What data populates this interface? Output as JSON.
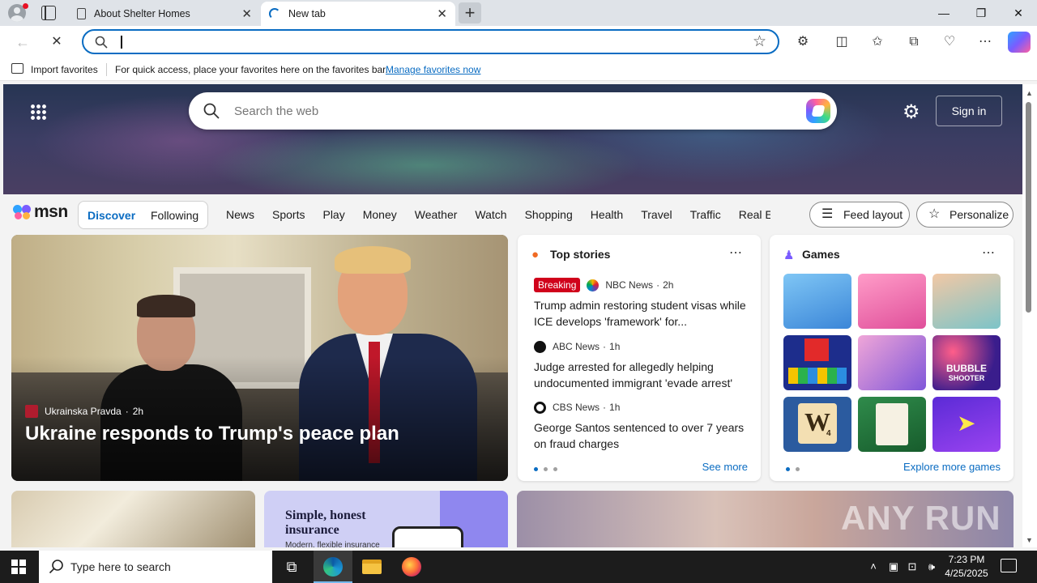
{
  "browser": {
    "tabs": [
      {
        "title": "About Shelter Homes",
        "active": false
      },
      {
        "title": "New tab",
        "active": true
      }
    ],
    "address": {
      "value": "",
      "placeholder": ""
    },
    "favorites_bar": {
      "import_label": "Import favorites",
      "hint": "For quick access, place your favorites here on the favorites bar.",
      "manage_link": "Manage favorites now"
    }
  },
  "newtab": {
    "search_placeholder": "Search the web",
    "signin_label": "Sign in",
    "msn": {
      "logo": "msn",
      "tabs": [
        "Discover",
        "Following"
      ],
      "nav": [
        "News",
        "Sports",
        "Play",
        "Money",
        "Weather",
        "Watch",
        "Shopping",
        "Health",
        "Travel",
        "Traffic",
        "Real E"
      ],
      "feed_layout": "Feed layout",
      "personalize": "Personalize"
    },
    "hero": {
      "source": "Ukrainska Pravda",
      "age": "2h",
      "title": "Ukraine responds to Trump's peace plan"
    },
    "top_stories": {
      "title": "Top stories",
      "breaking_label": "Breaking",
      "items": [
        {
          "source": "NBC News",
          "age": "2h",
          "headline": "Trump admin restoring student visas while ICE develops 'framework' for..."
        },
        {
          "source": "ABC News",
          "age": "1h",
          "headline": "Judge arrested for allegedly helping undocumented immigrant 'evade arrest'"
        },
        {
          "source": "CBS News",
          "age": "1h",
          "headline": "George Santos sentenced to over 7 years on fraud charges"
        }
      ],
      "see_more": "See more"
    },
    "games": {
      "title": "Games",
      "tile_labels": [
        "BUBBLE",
        "SHOOTER",
        "W",
        "4"
      ],
      "explore": "Explore more games"
    },
    "insurance_ad": {
      "title": "Simple, honest insurance",
      "subtitle": "Modern, flexible insurance"
    },
    "watermark": "ANY RUN"
  },
  "taskbar": {
    "search_placeholder": "Type here to search",
    "time": "7:23 PM",
    "date": "4/25/2025"
  },
  "colors": {
    "accent": "#0a6cc2",
    "breaking": "#d0021b"
  }
}
